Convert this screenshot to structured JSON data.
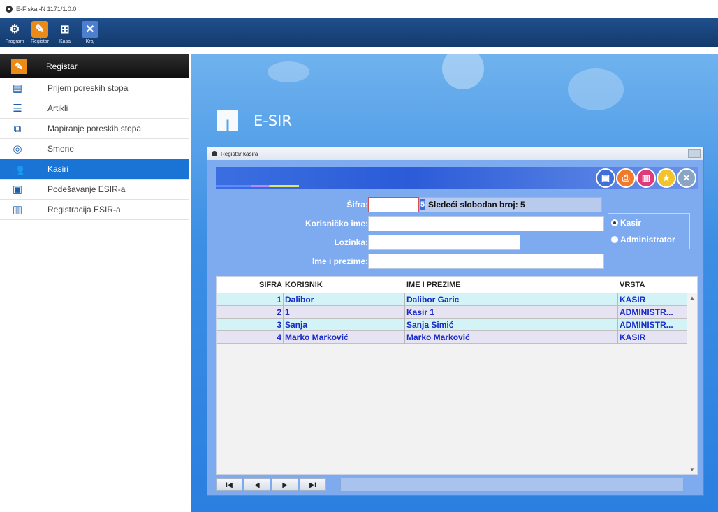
{
  "window": {
    "title": "E-Fiskal-N 1171/1.0.0"
  },
  "toolbar": {
    "items": [
      {
        "label": "Program",
        "icon": "gear-icon"
      },
      {
        "label": "Registar",
        "icon": "pencil-icon"
      },
      {
        "label": "Kasa",
        "icon": "basket-icon"
      },
      {
        "label": "Kraj",
        "icon": "close-icon"
      }
    ]
  },
  "sidebar": {
    "header": "Registar",
    "items": [
      {
        "label": "Prijem poreskih stopa",
        "icon": "tax-document-icon",
        "active": false
      },
      {
        "label": "Artikli",
        "icon": "articles-icon",
        "active": false
      },
      {
        "label": "Mapiranje poreskih stopa",
        "icon": "mapping-icon",
        "active": false
      },
      {
        "label": "Smene",
        "icon": "shifts-icon",
        "active": false
      },
      {
        "label": "Kasiri",
        "icon": "users-icon",
        "active": true
      },
      {
        "label": "Podešavanje ESIR-a",
        "icon": "settings-icon",
        "active": false
      },
      {
        "label": "Registracija ESIR-a",
        "icon": "registration-icon",
        "active": false
      }
    ]
  },
  "brand": {
    "name": "E-SIR"
  },
  "dialog": {
    "title": "Registar kasira",
    "toolbar_icons": [
      "save-icon",
      "print-icon",
      "delete-icon",
      "star-icon",
      "close-icon"
    ],
    "form": {
      "sifra_label": "Šifra:",
      "sifra_value": "",
      "next_free_label": "Sledeći slobodan broj: 5",
      "next_free_marker": "5",
      "username_label": "Korisničko ime:",
      "username_value": "",
      "password_label": "Lozinka:",
      "password_value": "",
      "fullname_label": "Ime i prezime:",
      "fullname_value": "",
      "role_options": [
        "Kasir",
        "Administrator"
      ],
      "role_selected": "Kasir"
    },
    "table": {
      "columns": [
        "SIFRA",
        "KORISNIK",
        "IME I PREZIME",
        "VRSTA"
      ],
      "rows": [
        {
          "sifra": "1",
          "korisnik": "Dalibor",
          "ime": "Dalibor Garic",
          "vrsta": "KASIR"
        },
        {
          "sifra": "2",
          "korisnik": "1",
          "ime": "Kasir 1",
          "vrsta": "ADMINISTR..."
        },
        {
          "sifra": "3",
          "korisnik": "Sanja",
          "ime": "Sanja Simić",
          "vrsta": "ADMINISTR..."
        },
        {
          "sifra": "4",
          "korisnik": "Marko Marković",
          "ime": "Marko Marković",
          "vrsta": "KASIR"
        }
      ]
    },
    "navigator": {
      "first": "I◀",
      "prev": "◀",
      "next": "▶",
      "last": "▶I"
    }
  }
}
